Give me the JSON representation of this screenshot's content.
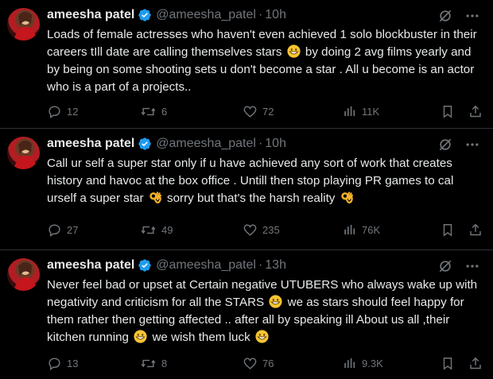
{
  "colors": {
    "background": "#000000",
    "text": "#e7e9ea",
    "muted": "#71767b",
    "verified": "#1d9bf0",
    "divider": "#2f3336"
  },
  "tweets": [
    {
      "name": "ameesha patel",
      "handle": "@ameesha_patel",
      "separator": "·",
      "time": "10h",
      "text_segments": [
        "Loads of female actresses who haven't even achieved 1 solo  blockbuster in their careers tIll date are calling themselves stars ",
        " by doing 2 avg films yearly and by being on some shooting sets u don't become a star . All u become is an actor who is a part of a projects.."
      ],
      "emojis": [
        "grinning-face-emoji"
      ],
      "replies": "12",
      "reposts": "6",
      "likes": "72",
      "views": "11K"
    },
    {
      "name": "ameesha patel",
      "handle": "@ameesha_patel",
      "separator": "·",
      "time": "10h",
      "text_segments": [
        "Call ur self a super star only if u have achieved any sort of work that creates history and havoc  at the box office . Untill then stop playing PR games to cal urself a super star ",
        " sorry but that's the harsh reality ",
        ""
      ],
      "emojis": [
        "ok-hand-emoji",
        "ok-hand-emoji"
      ],
      "replies": "27",
      "reposts": "49",
      "likes": "235",
      "views": "76K"
    },
    {
      "name": "ameesha patel",
      "handle": "@ameesha_patel",
      "separator": "·",
      "time": "13h",
      "text_segments": [
        "Never feel  bad or upset at  Certain negative UTUBERS who always wake up with negativity and criticism for all the STARS ",
        " we as stars should feel happy for them rather then getting affected .. after all by speaking ill About us all ,their kitchen   running ",
        " we wish them luck ",
        ""
      ],
      "emojis": [
        "grinning-face-emoji",
        "grinning-face-emoji",
        "grinning-face-emoji"
      ],
      "replies": "13",
      "reposts": "8",
      "likes": "76",
      "views": "9.3K"
    }
  ]
}
